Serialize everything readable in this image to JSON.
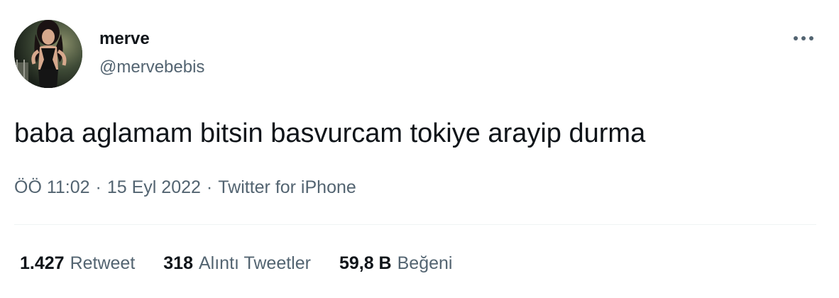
{
  "author": {
    "display_name": "merve",
    "handle": "@mervebebis"
  },
  "tweet": {
    "text": "baba aglamam bitsin basvurcam tokiye arayip durma"
  },
  "meta": {
    "time": "ÖÖ 11:02",
    "separator": "·",
    "date": "15 Eyl 2022",
    "source": "Twitter for iPhone"
  },
  "stats": {
    "retweets": {
      "count": "1.427",
      "label": "Retweet"
    },
    "quotes": {
      "count": "318",
      "label": "Alıntı Tweetler"
    },
    "likes": {
      "count": "59,8 B",
      "label": "Beğeni"
    }
  },
  "icons": {
    "more": "more-horizontal-icon"
  },
  "colors": {
    "primary_text": "#0f1419",
    "secondary_text": "#536471",
    "divider": "#eff3f4"
  }
}
